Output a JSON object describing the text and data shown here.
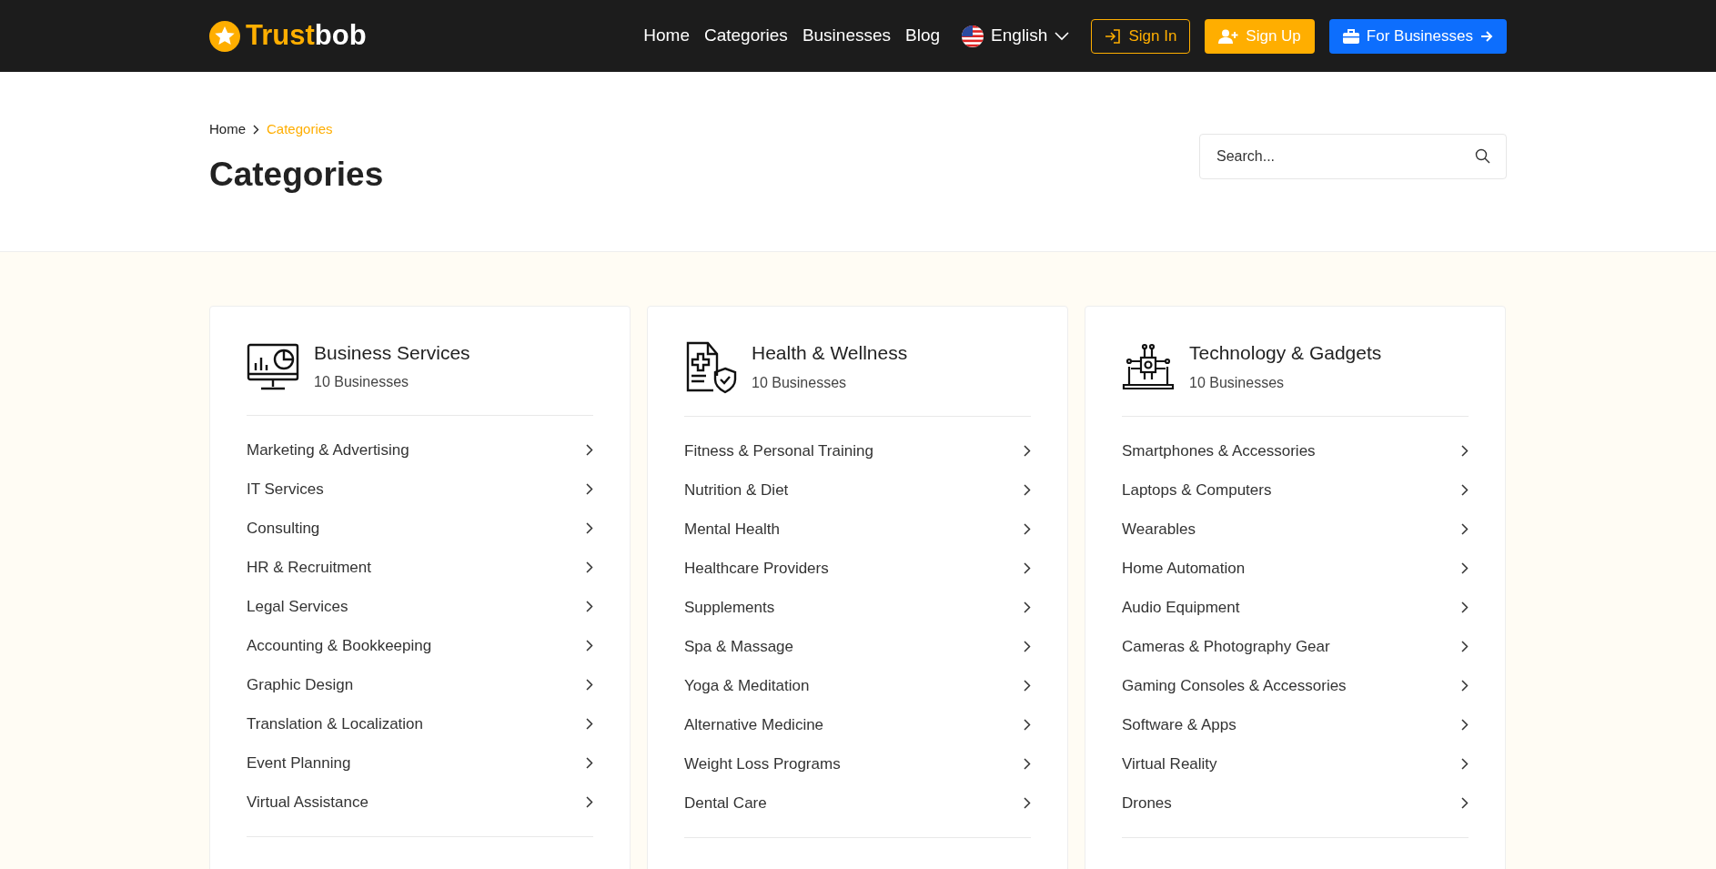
{
  "logo": {
    "first": "Trust",
    "second": "bob"
  },
  "nav": [
    {
      "label": "Home"
    },
    {
      "label": "Categories"
    },
    {
      "label": "Businesses"
    },
    {
      "label": "Blog"
    }
  ],
  "language": {
    "label": "English"
  },
  "buttons": [
    {
      "label": "Sign In",
      "kind": "outline"
    },
    {
      "label": "Sign Up",
      "kind": "accent"
    },
    {
      "label": "For Businesses",
      "kind": "primary"
    }
  ],
  "breadcrumb": [
    {
      "label": "Home",
      "current": false
    },
    {
      "label": "Categories",
      "current": true
    }
  ],
  "page_title": "Categories",
  "search": {
    "placeholder": "Search..."
  },
  "categories": [
    {
      "name": "Business Services",
      "count": "10 Businesses",
      "items": [
        "Marketing & Advertising",
        "IT Services",
        "Consulting",
        "HR & Recruitment",
        "Legal Services",
        "Accounting & Bookkeeping",
        "Graphic Design",
        "Translation & Localization",
        "Event Planning",
        "Virtual Assistance"
      ]
    },
    {
      "name": "Health & Wellness",
      "count": "10 Businesses",
      "items": [
        "Fitness & Personal Training",
        "Nutrition & Diet",
        "Mental Health",
        "Healthcare Providers",
        "Supplements",
        "Spa & Massage",
        "Yoga & Meditation",
        "Alternative Medicine",
        "Weight Loss Programs",
        "Dental Care"
      ]
    },
    {
      "name": "Technology & Gadgets",
      "count": "10 Businesses",
      "items": [
        "Smartphones & Accessories",
        "Laptops & Computers",
        "Wearables",
        "Home Automation",
        "Audio Equipment",
        "Cameras & Photography Gear",
        "Gaming Consoles & Accessories",
        "Software & Apps",
        "Virtual Reality",
        "Drones"
      ]
    }
  ]
}
